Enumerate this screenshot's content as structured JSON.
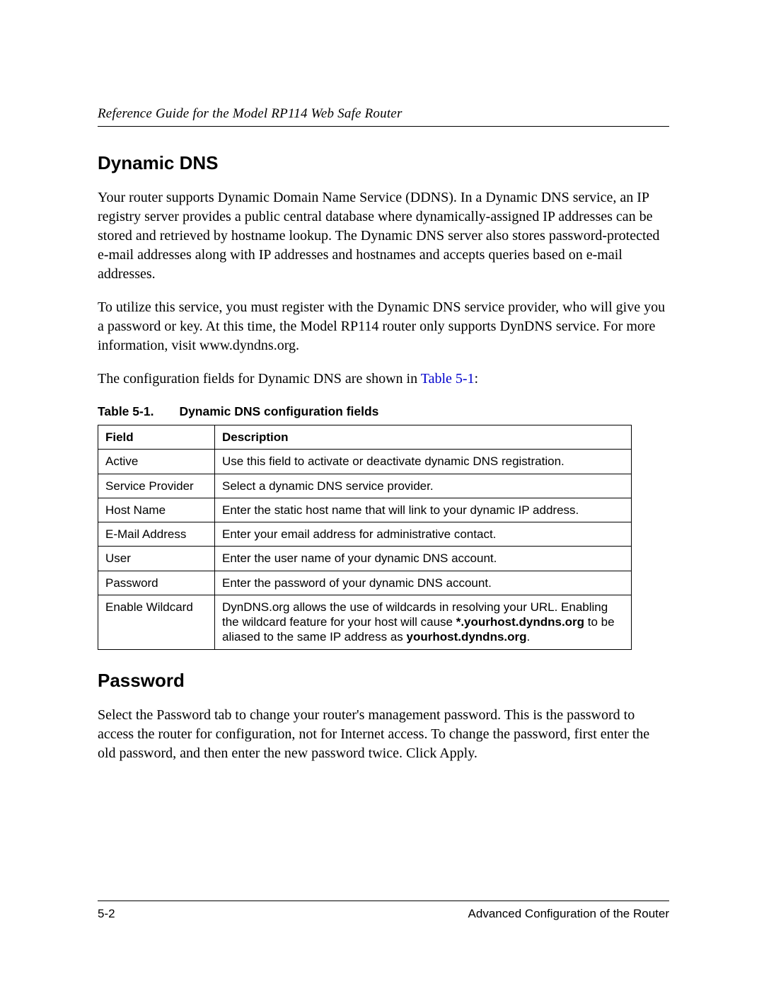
{
  "header": {
    "running_title": "Reference Guide for the Model RP114 Web Safe Router"
  },
  "section1": {
    "title": "Dynamic DNS",
    "para1": "Your router supports Dynamic Domain Name Service (DDNS). In a Dynamic DNS service, an IP registry server provides a public central database where dynamically-assigned IP addresses can be stored and retrieved by hostname lookup. The Dynamic DNS server also stores password-protected e-mail addresses along with IP addresses and hostnames and accepts queries based on e-mail addresses.",
    "para2": "To utilize this service, you must register with the Dynamic DNS service provider, who will give you a password or key. At this time, the Model RP114 router only supports DynDNS service. For more information, visit www.dyndns.org.",
    "para3_pre": "The configuration fields for Dynamic DNS are shown in ",
    "para3_link": "Table 5-1",
    "para3_post": ":"
  },
  "table": {
    "caption_number": "Table 5-1.",
    "caption_title": "Dynamic DNS configuration fields",
    "head_field": "Field",
    "head_desc": "Description",
    "rows": [
      {
        "field": "Active",
        "desc": "Use this field to activate or deactivate dynamic DNS registration."
      },
      {
        "field": "Service Provider",
        "desc": "Select a dynamic DNS service provider."
      },
      {
        "field": "Host Name",
        "desc": "Enter the static host name that will link to your dynamic IP address."
      },
      {
        "field": "E-Mail Address",
        "desc": "Enter your email address for administrative contact."
      },
      {
        "field": "User",
        "desc": "Enter the user name of your dynamic DNS account."
      },
      {
        "field": "Password",
        "desc": "Enter the password of your dynamic DNS account."
      }
    ],
    "wildcard": {
      "field": "Enable Wildcard",
      "line1": "DynDNS.org allows the use of wildcards in resolving your URL. Enabling the wildcard feature for your host will cause ",
      "bold1": "*.yourhost.dyndns.org",
      "line2": " to be aliased to the same IP address as ",
      "bold2": "yourhost.dyndns.org",
      "line3": "."
    }
  },
  "section2": {
    "title": "Password",
    "para1": "Select the Password tab to change your router's management password. This is the password to access the router for configuration, not for Internet access. To change the password, first enter the old password, and then enter the new password twice. Click Apply."
  },
  "footer": {
    "page_number": "5-2",
    "chapter": "Advanced Configuration of the Router"
  }
}
